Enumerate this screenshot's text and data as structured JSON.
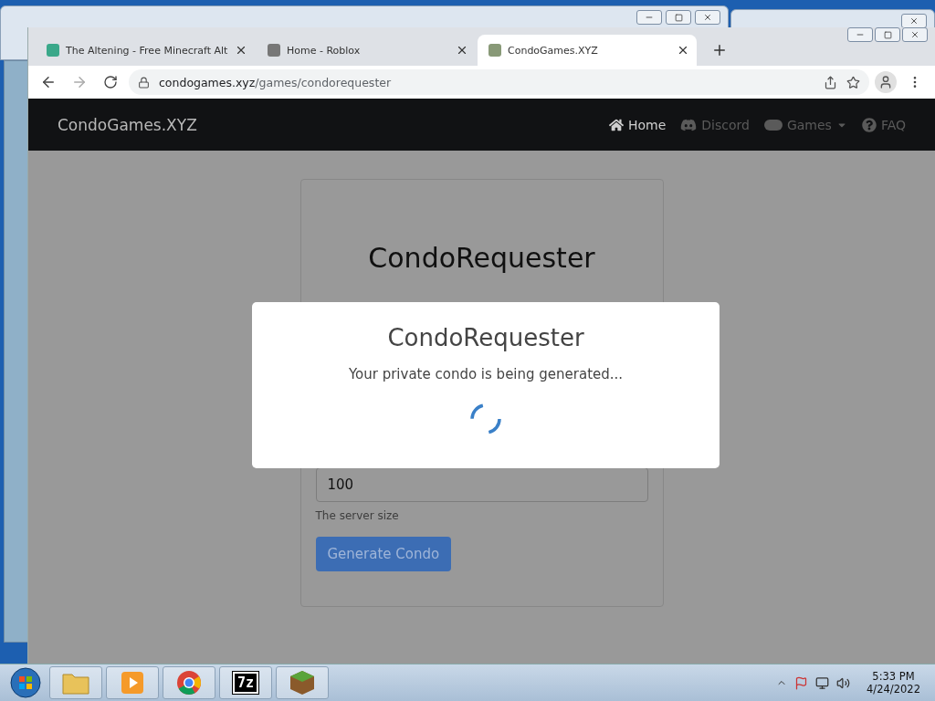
{
  "browser": {
    "tabs": [
      {
        "title": "The Altening - Free Minecraft Alt",
        "kind": "altening",
        "selected": false
      },
      {
        "title": "Home - Roblox",
        "kind": "roblox",
        "selected": false
      },
      {
        "title": "CondoGames.XYZ",
        "kind": "condo",
        "selected": true
      }
    ],
    "url": {
      "domain": "condogames.xyz",
      "path": "/games/condorequester"
    }
  },
  "navbar": {
    "brand": "CondoGames.XYZ",
    "links": [
      {
        "label": "Home",
        "kind": "home",
        "selected": true
      },
      {
        "label": "Discord",
        "kind": "discord",
        "selected": false
      },
      {
        "label": "Games",
        "kind": "games",
        "selected": false,
        "dropdown": true
      },
      {
        "label": "FAQ",
        "kind": "faq",
        "selected": false
      }
    ]
  },
  "card": {
    "title": "CondoRequester",
    "field_value": "100",
    "field_help": "The server size",
    "button": "Generate Condo"
  },
  "modal": {
    "title": "CondoRequester",
    "message": "Your private condo is being generated..."
  },
  "taskbar": {
    "apps": [
      {
        "kind": "explorer"
      },
      {
        "kind": "media"
      },
      {
        "kind": "chrome"
      },
      {
        "kind": "archiver",
        "label": "7z"
      },
      {
        "kind": "minecraft"
      }
    ],
    "clock": {
      "time": "5:33 PM",
      "date": "4/24/2022"
    }
  }
}
